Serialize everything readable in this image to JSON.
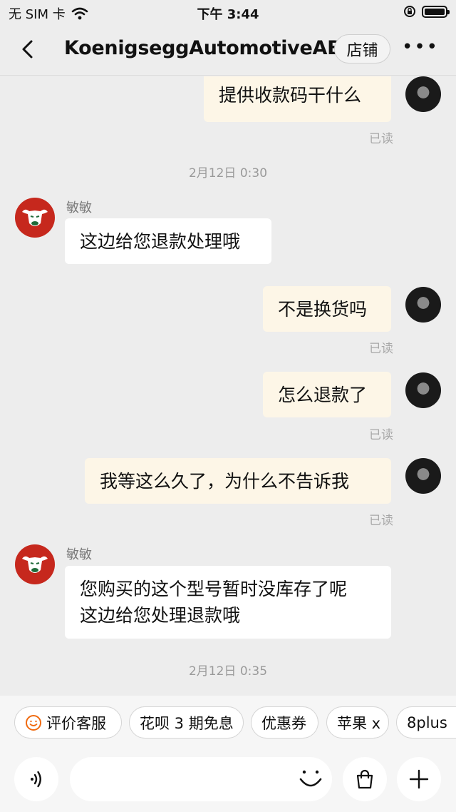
{
  "status_bar": {
    "carrier": "无 SIM 卡",
    "time": "下午 3:44",
    "battery_level": 1.0
  },
  "header": {
    "title": "KoenigseggAutomotiveAB",
    "shop_button": "店铺"
  },
  "messages": {
    "m1": {
      "text": "提供收款码干什么",
      "status": "已读"
    },
    "ts1": "2月12日 0:30",
    "m2": {
      "sender": "敏敏",
      "text": "这边给您退款处理哦"
    },
    "m3": {
      "text": "不是换货吗",
      "status": "已读"
    },
    "m4": {
      "text": "怎么退款了",
      "status": "已读"
    },
    "m5": {
      "text": "我等这么久了，为什么不告诉我",
      "status": "已读"
    },
    "m6": {
      "sender": "敏敏",
      "line1": "您购买的这个型号暂时没库存了呢",
      "line2": "这边给您处理退款哦"
    },
    "ts2": "2月12日 0:35"
  },
  "quick_replies": [
    "评价客服",
    "花呗 3 期免息",
    "优惠券",
    "苹果 x",
    "8plus"
  ],
  "icons": {
    "back": "chevron-left-icon",
    "more": "more-dots-icon",
    "voice": "voice-icon",
    "emoji": "smile-icon",
    "bag": "shopping-bag-icon",
    "add": "plus-icon",
    "rate": "smiley-badge-icon"
  },
  "colors": {
    "my_bubble": "#fdf6e7",
    "their_bubble": "#ffffff",
    "accent": "#f06a0f",
    "shop_avatar": "#c6281d"
  }
}
